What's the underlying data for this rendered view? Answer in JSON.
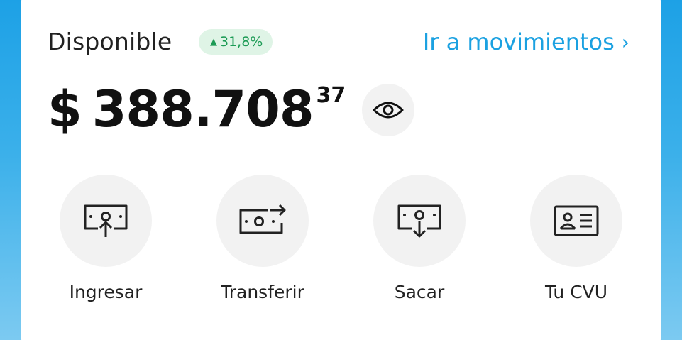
{
  "balance": {
    "label": "Disponible",
    "change_badge": {
      "icon": "triangle-up-icon",
      "value": "31,8%",
      "color": "#1c9b55"
    },
    "movements_link": "Ir a movimientos",
    "currency_symbol": "$",
    "amount_integer": "388.708",
    "amount_cents": "37"
  },
  "actions": [
    {
      "label": "Ingresar",
      "icon": "deposit-money-icon"
    },
    {
      "label": "Transferir",
      "icon": "transfer-money-icon"
    },
    {
      "label": "Sacar",
      "icon": "withdraw-money-icon"
    },
    {
      "label": "Tu CVU",
      "icon": "id-card-icon"
    }
  ],
  "colors": {
    "accent": "#1ba1e1",
    "background_top": "#1da1e6",
    "badge_bg": "#dff4e6"
  }
}
